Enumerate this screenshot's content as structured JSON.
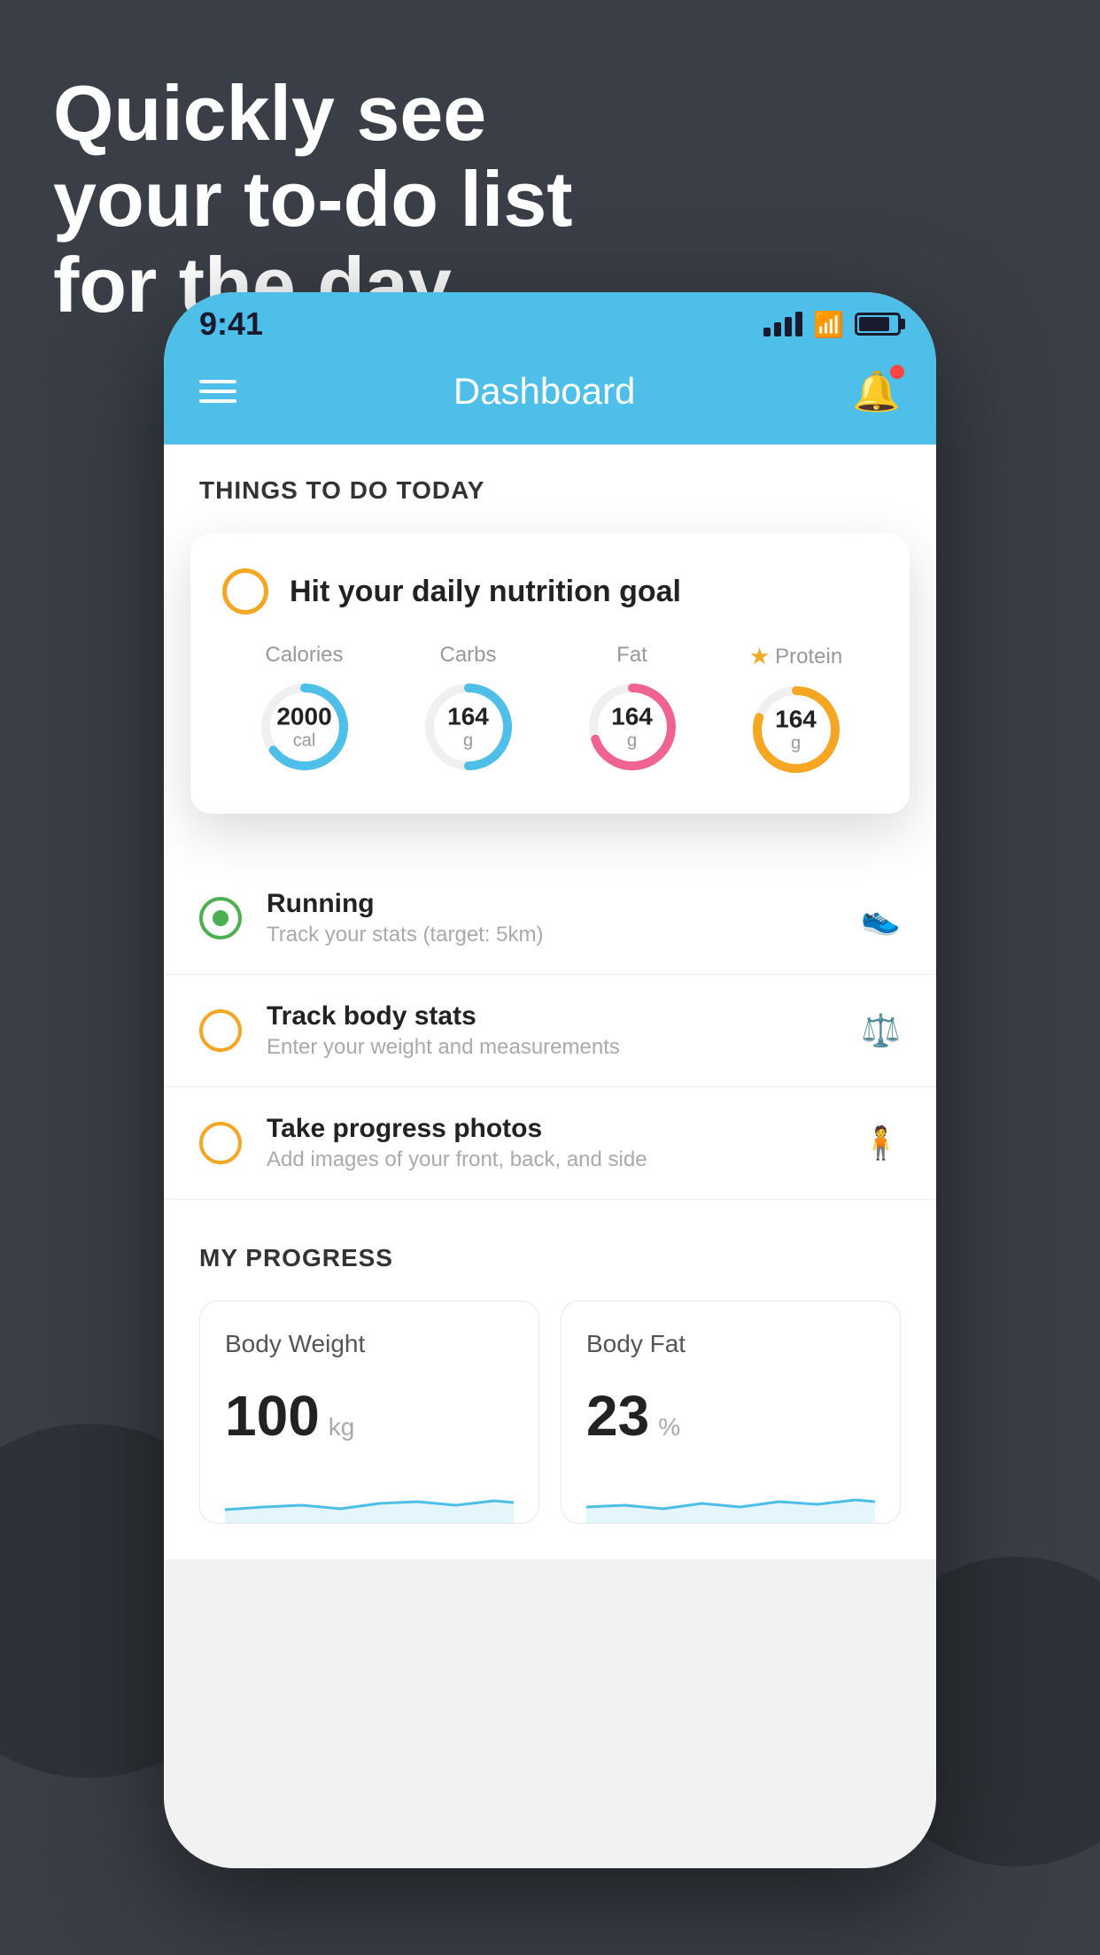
{
  "headline": {
    "line1": "Quickly see",
    "line2": "your to-do list",
    "line3": "for the day."
  },
  "phone": {
    "status_bar": {
      "time": "9:41"
    },
    "header": {
      "title": "Dashboard"
    },
    "things_section": {
      "heading": "THINGS TO DO TODAY"
    },
    "floating_card": {
      "title": "Hit your daily nutrition goal",
      "stats": [
        {
          "label": "Calories",
          "value": "2000",
          "unit": "cal",
          "color": "blue",
          "percent": 65
        },
        {
          "label": "Carbs",
          "value": "164",
          "unit": "g",
          "color": "blue",
          "percent": 50
        },
        {
          "label": "Fat",
          "value": "164",
          "unit": "g",
          "color": "pink",
          "percent": 70
        },
        {
          "label": "Protein",
          "value": "164",
          "unit": "g",
          "color": "yellow",
          "percent": 80,
          "starred": true
        }
      ]
    },
    "todo_items": [
      {
        "title": "Running",
        "subtitle": "Track your stats (target: 5km)",
        "status": "active",
        "icon": "shoe"
      },
      {
        "title": "Track body stats",
        "subtitle": "Enter your weight and measurements",
        "status": "pending",
        "icon": "scale"
      },
      {
        "title": "Take progress photos",
        "subtitle": "Add images of your front, back, and side",
        "status": "pending",
        "icon": "person"
      }
    ],
    "progress_section": {
      "heading": "MY PROGRESS",
      "cards": [
        {
          "title": "Body Weight",
          "value": "100",
          "unit": "kg"
        },
        {
          "title": "Body Fat",
          "value": "23",
          "unit": "%"
        }
      ]
    }
  }
}
